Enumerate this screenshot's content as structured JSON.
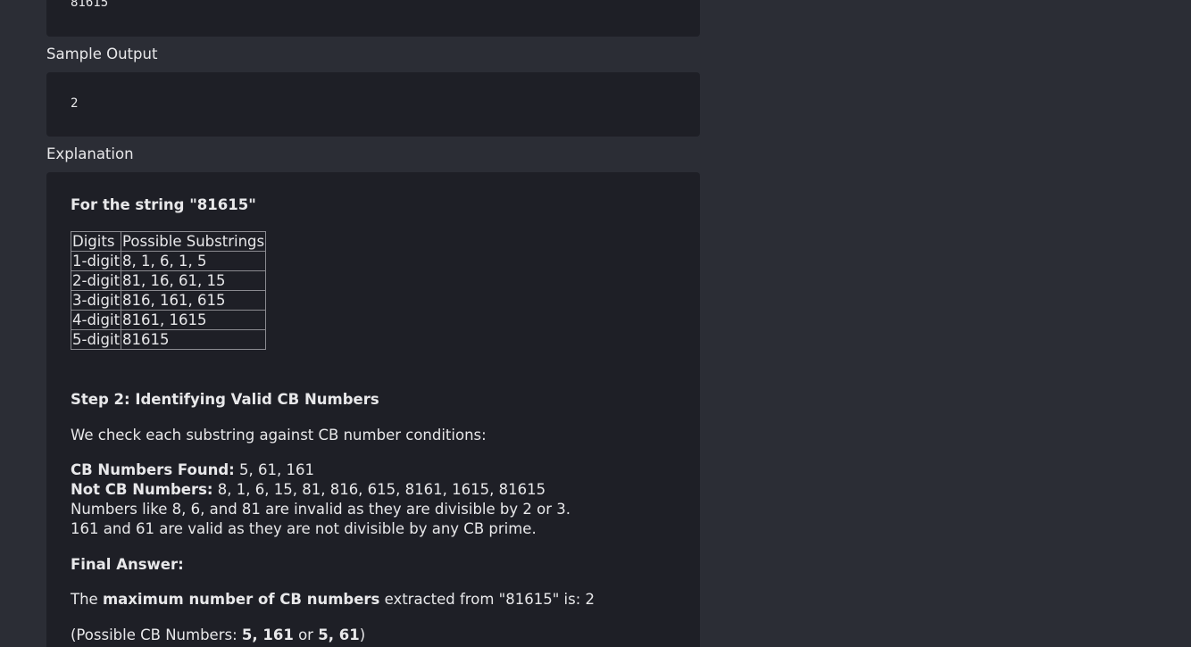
{
  "sample_input": {
    "value": "81615"
  },
  "sample_output": {
    "heading": "Sample Output",
    "value": "2"
  },
  "explanation": {
    "heading": "Explanation",
    "intro": "For the string \"81615\"",
    "table": {
      "headers": [
        "Digits",
        "Possible Substrings"
      ],
      "rows": [
        [
          "1-digit",
          "8, 1, 6, 1, 5"
        ],
        [
          "2-digit",
          "81, 16, 61, 15"
        ],
        [
          "3-digit",
          "816, 161, 615"
        ],
        [
          "4-digit",
          "8161, 1615"
        ],
        [
          "5-digit",
          "81615"
        ]
      ]
    },
    "step2_title": "Step 2: Identifying Valid CB Numbers",
    "step2_text": "We check each substring against CB number conditions:",
    "found_label": "CB Numbers Found:",
    "found_value": " 5, 61, 161",
    "not_label": "Not CB Numbers:",
    "not_value": " 8, 1, 6, 15, 81, 816, 615, 8161, 1615, 81615",
    "invalid_note": "Numbers like 8, 6, and 81 are invalid as they are divisible by 2 or 3.",
    "valid_note": "161 and 61 are valid as they are not divisible by any CB prime.",
    "final_title": "Final Answer:",
    "final_prefix": "The ",
    "final_bold": "maximum number of CB numbers",
    "final_suffix": " extracted from \"81615\" is: 2",
    "possible_prefix": "(Possible CB Numbers: ",
    "possible_a": "5, 161",
    "possible_or": " or ",
    "possible_b": "5, 61",
    "possible_suffix": ")"
  }
}
